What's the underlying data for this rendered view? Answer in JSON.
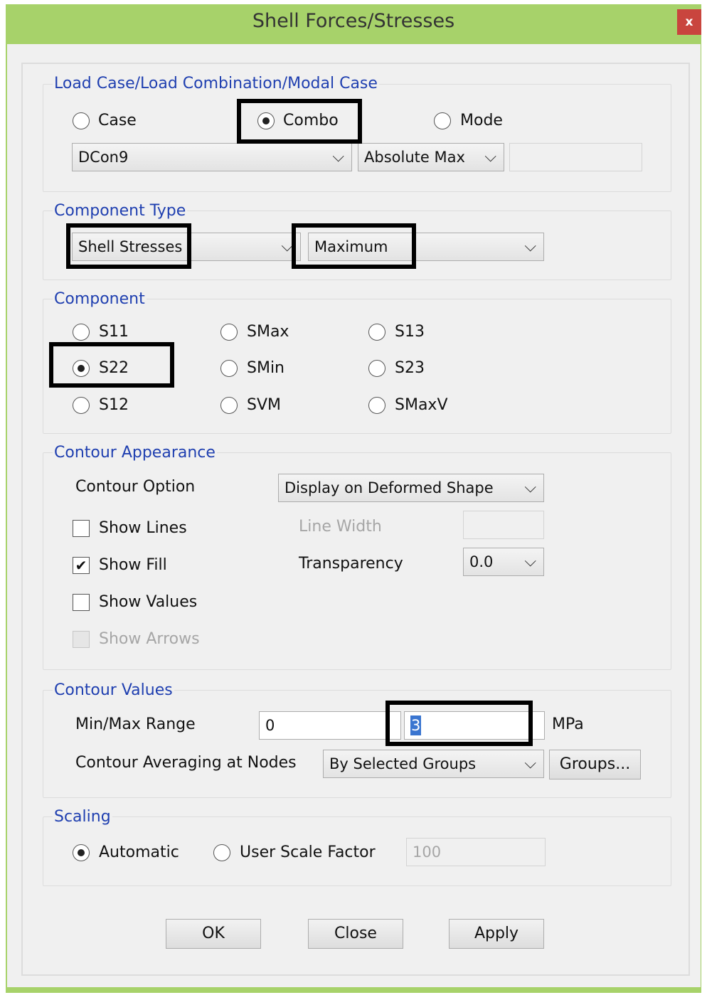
{
  "window": {
    "title": "Shell Forces/Stresses",
    "close_glyph": "x"
  },
  "load_case": {
    "legend": "Load Case/Load Combination/Modal Case",
    "options": [
      "Case",
      "Combo",
      "Mode"
    ],
    "selected": "Combo",
    "combo_value": "DCon9",
    "envelope_value": "Absolute Max",
    "extra_value": ""
  },
  "component_type": {
    "legend": "Component Type",
    "type_value": "Shell Stresses",
    "stat_value": "Maximum"
  },
  "component": {
    "legend": "Component",
    "options": [
      "S11",
      "SMax",
      "S13",
      "S22",
      "SMin",
      "S23",
      "S12",
      "SVM",
      "SMaxV"
    ],
    "selected": "S22"
  },
  "contour_appearance": {
    "legend": "Contour Appearance",
    "contour_option_label": "Contour Option",
    "contour_option_value": "Display on Deformed Shape",
    "show_lines": "Show Lines",
    "show_fill": "Show Fill",
    "show_values": "Show Values",
    "show_arrows": "Show Arrows",
    "line_width_label": "Line Width",
    "line_width_value": "",
    "transparency_label": "Transparency",
    "transparency_value": "0.0",
    "checked": {
      "show_lines": false,
      "show_fill": true,
      "show_values": false,
      "show_arrows": false
    },
    "check_glyph": "✔"
  },
  "contour_values": {
    "legend": "Contour Values",
    "range_label": "Min/Max Range",
    "min_value": "0",
    "max_value": "3",
    "unit": "MPa",
    "averaging_label": "Contour Averaging at Nodes",
    "averaging_value": "By Selected Groups",
    "groups_button": "Groups..."
  },
  "scaling": {
    "legend": "Scaling",
    "automatic": "Automatic",
    "user_scale": "User Scale Factor",
    "scale_value": "100",
    "selected": "Automatic"
  },
  "buttons": {
    "ok": "OK",
    "close": "Close",
    "apply": "Apply"
  },
  "icons": {
    "dropdown": "chevron-down-icon",
    "close": "close-icon"
  },
  "colors": {
    "titlebar": "#a7d26a",
    "close": "#c9453e",
    "legend": "#1f3fb0",
    "highlight": "#000000"
  }
}
